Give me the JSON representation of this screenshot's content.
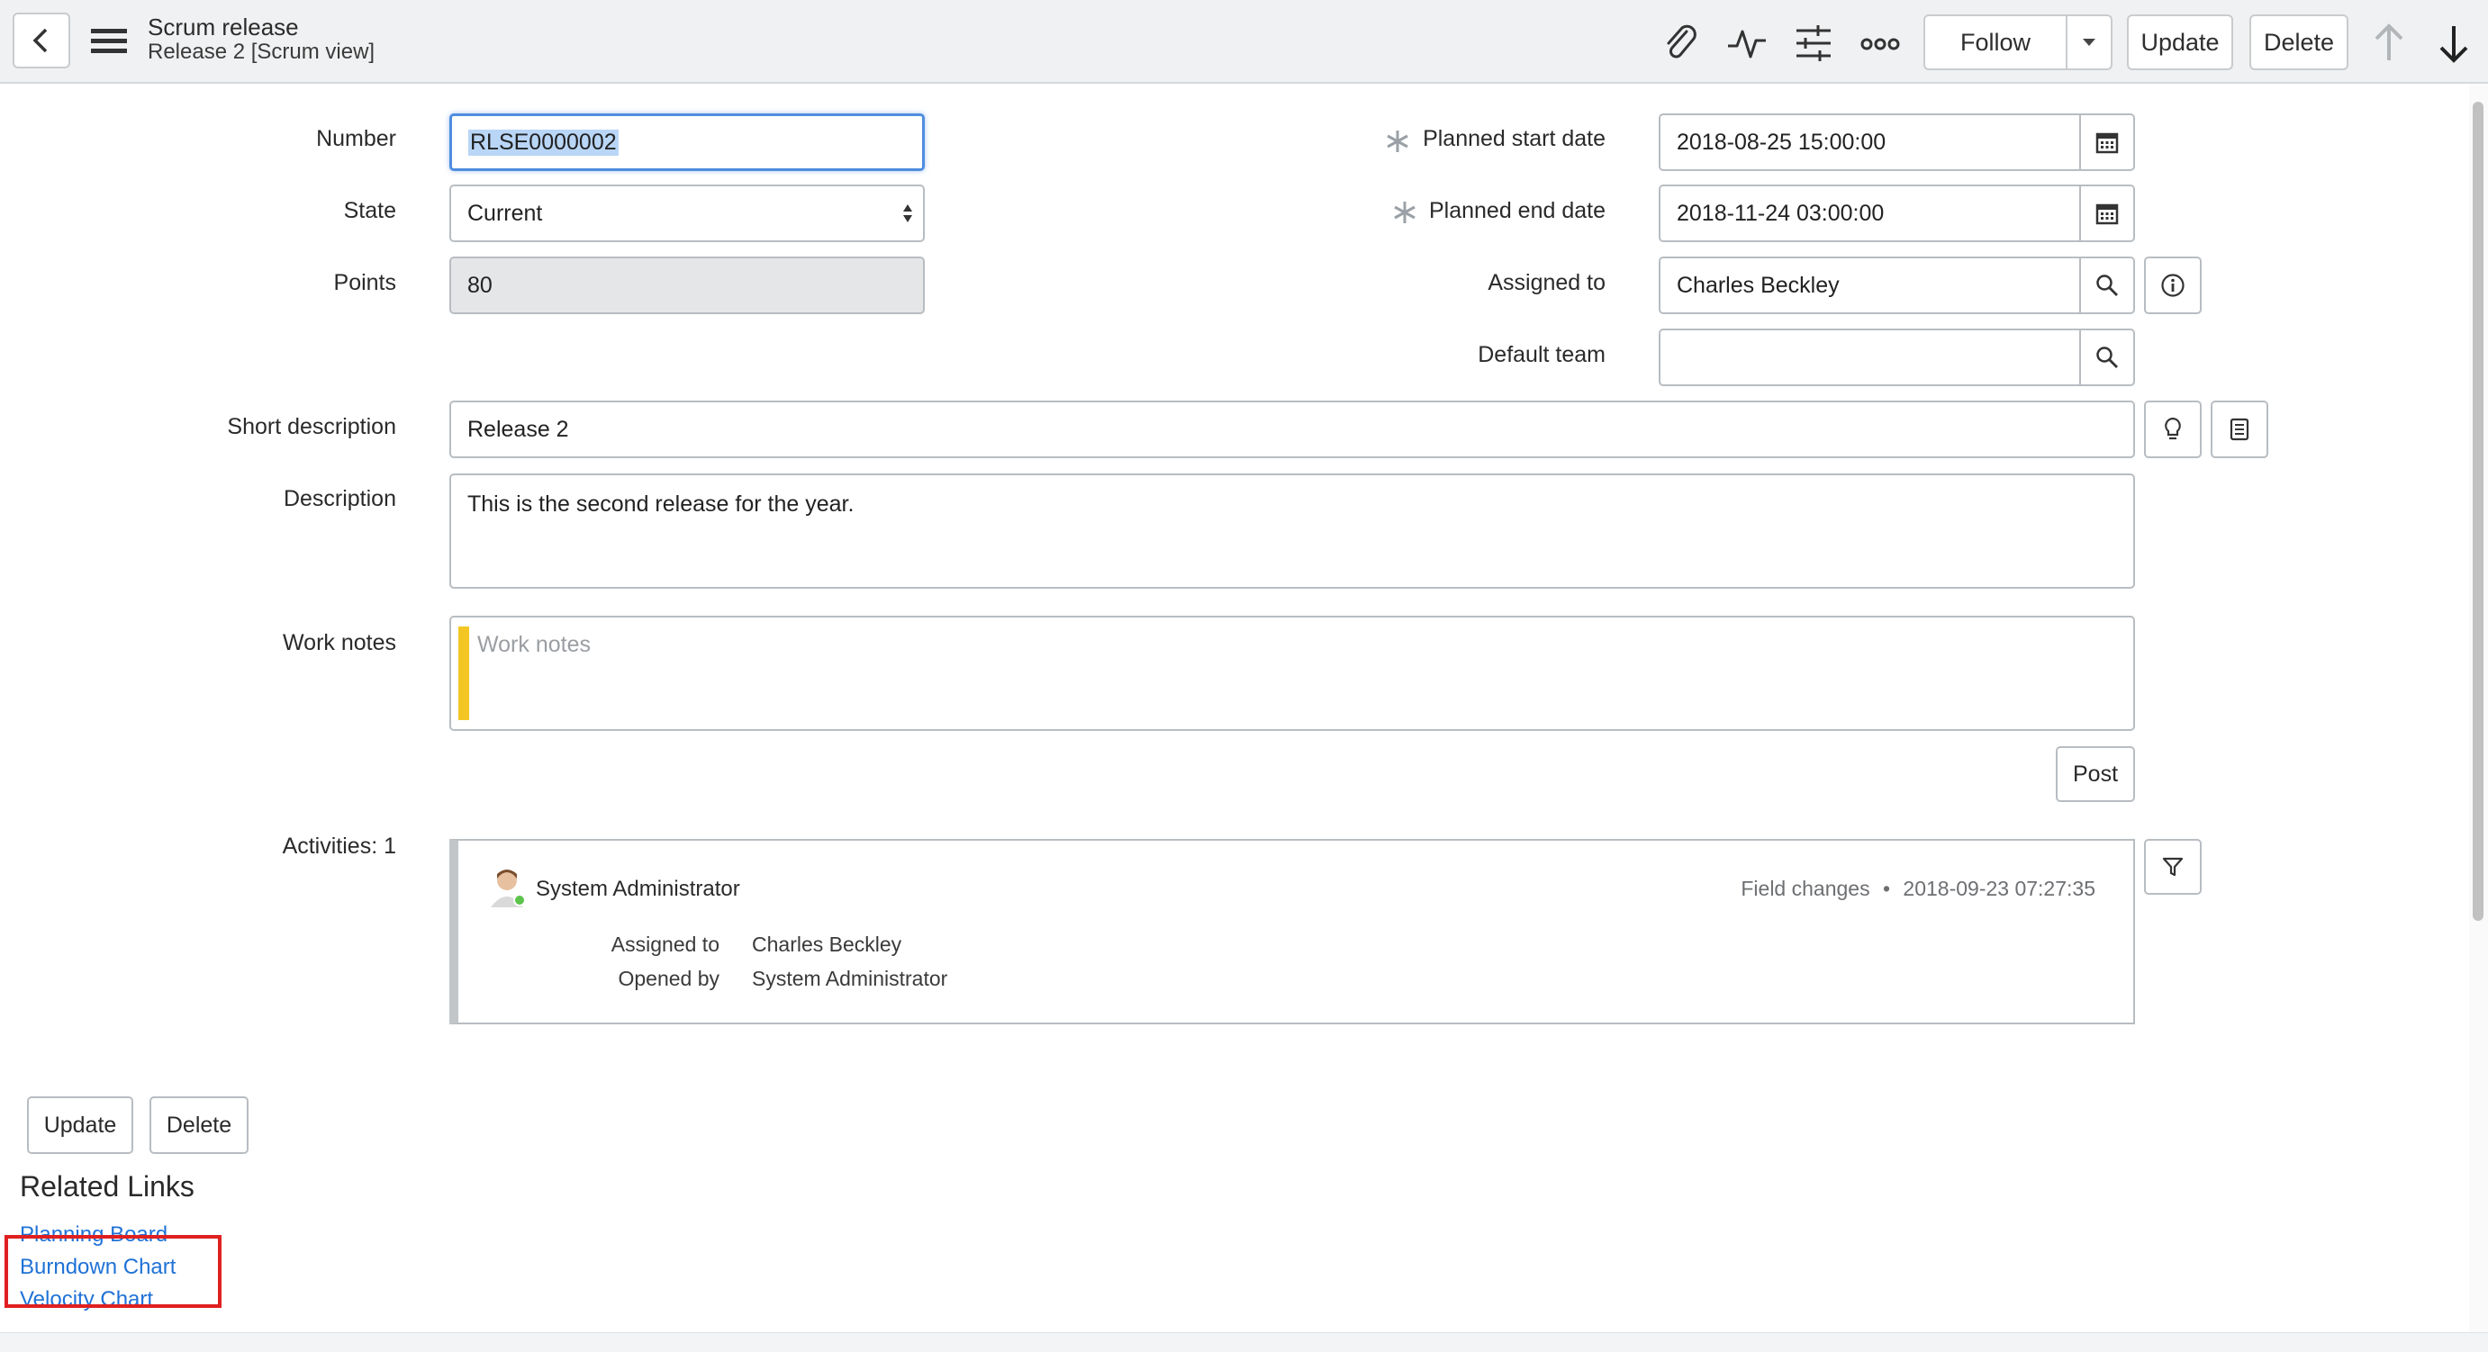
{
  "header": {
    "title": "Scrum release",
    "subtitle": "Release 2 [Scrum view]",
    "follow_label": "Follow",
    "update_label": "Update",
    "delete_label": "Delete"
  },
  "form": {
    "number": {
      "label": "Number",
      "value": "RLSE0000002"
    },
    "state": {
      "label": "State",
      "value": "Current"
    },
    "points": {
      "label": "Points",
      "value": "80"
    },
    "planned_start": {
      "label": "Planned start date",
      "value": "2018-08-25 15:00:00"
    },
    "planned_end": {
      "label": "Planned end date",
      "value": "2018-11-24 03:00:00"
    },
    "assigned_to": {
      "label": "Assigned to",
      "value": "Charles Beckley"
    },
    "default_team": {
      "label": "Default team",
      "value": ""
    },
    "short_description": {
      "label": "Short description",
      "value": "Release 2"
    },
    "description": {
      "label": "Description",
      "value": "This is the second release for the year."
    },
    "work_notes": {
      "label": "Work notes",
      "placeholder": "Work notes"
    },
    "post_label": "Post"
  },
  "activities": {
    "label": "Activities: 1",
    "entry": {
      "user": "System Administrator",
      "type": "Field changes",
      "timestamp": "2018-09-23 07:27:35",
      "changes": [
        {
          "field": "Assigned to",
          "value": "Charles Beckley"
        },
        {
          "field": "Opened by",
          "value": "System Administrator"
        }
      ]
    }
  },
  "footer": {
    "update_label": "Update",
    "delete_label": "Delete"
  },
  "related_links": {
    "title": "Related Links",
    "items": [
      "Planning Board",
      "Burndown Chart",
      "Velocity Chart"
    ]
  },
  "colors": {
    "link": "#1f72d6",
    "work_notes_bar": "#f3c623",
    "highlight_box": "#e02020",
    "focus": "#4f8de0"
  }
}
